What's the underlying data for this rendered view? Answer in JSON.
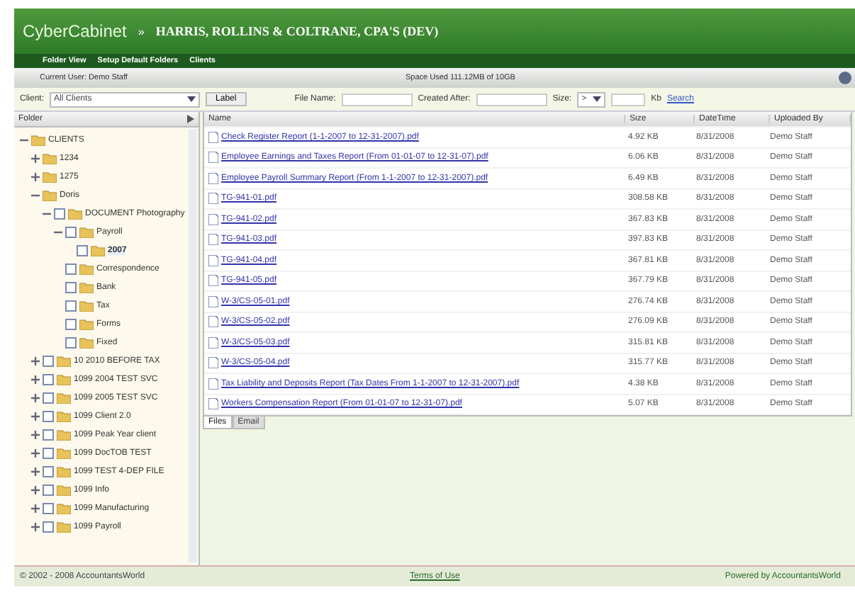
{
  "header": {
    "logo": "CyberCabinet",
    "separator": "»",
    "firm": "HARRIS, ROLLINS & COLTRANE, CPA'S (DEV)"
  },
  "menu": [
    "Folder View",
    "Setup Default Folders",
    "Clients"
  ],
  "user_bar": {
    "user": "Current User: Demo Staff",
    "space": "Space Used 111.12MB of 10GB"
  },
  "filter": {
    "client_label": "Client:",
    "client_value": "All Clients",
    "label_button": "Label",
    "file_name_label": "File Name:",
    "created_label": "Created After:",
    "size_label": "Size:",
    "size_op": ">",
    "size_unit": "Kb",
    "search": "Search"
  },
  "tree": {
    "heading": "Folder",
    "items": [
      {
        "label": "CLIENTS",
        "expanded": true,
        "selected": false,
        "children": [
          {
            "label": "1234",
            "expanded": false,
            "selected": false
          },
          {
            "label": "1275",
            "expanded": false,
            "selected": false
          },
          {
            "label": "Doris",
            "expanded": true,
            "selected": false,
            "children": [
              {
                "label": "DOCUMENT Photography",
                "kind": "check",
                "checked": false,
                "expanded": true,
                "selected": false,
                "children": [
                  {
                    "label": "Payroll",
                    "kind": "check",
                    "checked": false,
                    "expanded": true,
                    "selected": false,
                    "children": [
                      {
                        "label": "2007",
                        "kind": "check",
                        "checked": false,
                        "selected": true
                      }
                    ]
                  },
                  {
                    "label": "Correspondence",
                    "kind": "check",
                    "checked": false,
                    "selected": false
                  },
                  {
                    "label": "Bank",
                    "kind": "check",
                    "checked": false,
                    "selected": false
                  },
                  {
                    "label": "Tax",
                    "kind": "check",
                    "checked": false,
                    "selected": false
                  },
                  {
                    "label": "Forms",
                    "kind": "check",
                    "checked": false,
                    "selected": false
                  },
                  {
                    "label": "Fixed",
                    "kind": "check",
                    "checked": false,
                    "selected": false
                  }
                ]
              }
            ]
          },
          {
            "label": "10 2010 BEFORE TAX",
            "kind": "check",
            "checked": false,
            "expanded": false,
            "selected": false
          },
          {
            "label": "1099 2004 TEST SVC",
            "kind": "check",
            "checked": false,
            "expanded": false,
            "selected": false
          },
          {
            "label": "1099 2005 TEST SVC",
            "kind": "check",
            "checked": false,
            "expanded": false,
            "selected": false
          },
          {
            "label": "1099 Client 2.0",
            "kind": "check",
            "checked": false,
            "expanded": false,
            "selected": false
          },
          {
            "label": "1099 Peak Year client",
            "kind": "check",
            "checked": false,
            "expanded": false,
            "selected": false
          },
          {
            "label": "1099 DocTOB TEST",
            "kind": "check",
            "checked": false,
            "expanded": false,
            "selected": false
          },
          {
            "label": "1099 TEST 4-DEP FILE",
            "kind": "check",
            "checked": false,
            "expanded": false,
            "selected": false
          },
          {
            "label": "1099 Info",
            "kind": "check",
            "checked": false,
            "expanded": false,
            "selected": false
          },
          {
            "label": "1099 Manufacturing",
            "kind": "check",
            "checked": false,
            "expanded": false,
            "selected": false
          },
          {
            "label": "1099 Payroll",
            "kind": "check",
            "checked": false,
            "expanded": false,
            "selected": false
          }
        ]
      }
    ]
  },
  "grid": {
    "columns": [
      "Name",
      "Size",
      "DateTime",
      "Uploaded By"
    ],
    "rows": [
      [
        "Check Register Report (1-1-2007 to 12-31-2007).pdf",
        "4.92 KB",
        "8/31/2008",
        "Demo Staff"
      ],
      [
        "Employee Earnings and Taxes Report (From 01-01-07 to 12-31-07).pdf",
        "6.06 KB",
        "8/31/2008",
        "Demo Staff"
      ],
      [
        "Employee Payroll Summary Report (From 1-1-2007 to 12-31-2007).pdf",
        "6.49 KB",
        "8/31/2008",
        "Demo Staff"
      ],
      [
        "TG-941-01.pdf",
        "308.58 KB",
        "8/31/2008",
        "Demo Staff"
      ],
      [
        "TG-941-02.pdf",
        "367.83 KB",
        "8/31/2008",
        "Demo Staff"
      ],
      [
        "TG-941-03.pdf",
        "397.83 KB",
        "8/31/2008",
        "Demo Staff"
      ],
      [
        "TG-941-04.pdf",
        "367.81 KB",
        "8/31/2008",
        "Demo Staff"
      ],
      [
        "TG-941-05.pdf",
        "367.79 KB",
        "8/31/2008",
        "Demo Staff"
      ],
      [
        "W-3/CS-05-01.pdf",
        "276.74 KB",
        "8/31/2008",
        "Demo Staff"
      ],
      [
        "W-3/CS-05-02.pdf",
        "276.09 KB",
        "8/31/2008",
        "Demo Staff"
      ],
      [
        "W-3/CS-05-03.pdf",
        "315.81 KB",
        "8/31/2008",
        "Demo Staff"
      ],
      [
        "W-3/CS-05-04.pdf",
        "315.77 KB",
        "8/31/2008",
        "Demo Staff"
      ],
      [
        "Tax Liability and Deposits Report (Tax Dates From 1-1-2007 to 12-31-2007).pdf",
        "4.38 KB",
        "8/31/2008",
        "Demo Staff"
      ],
      [
        "Workers Compensation Report (From 01-01-07 to 12-31-07).pdf",
        "5.07 KB",
        "8/31/2008",
        "Demo Staff"
      ]
    ]
  },
  "tabs": [
    {
      "label": "Files",
      "selected": true
    },
    {
      "label": "Email",
      "selected": false
    }
  ],
  "footer": {
    "copyright": "© 2002 - 2008 AccountantsWorld",
    "terms": "Terms of Use",
    "powered": "Powered by AccountantsWorld"
  }
}
